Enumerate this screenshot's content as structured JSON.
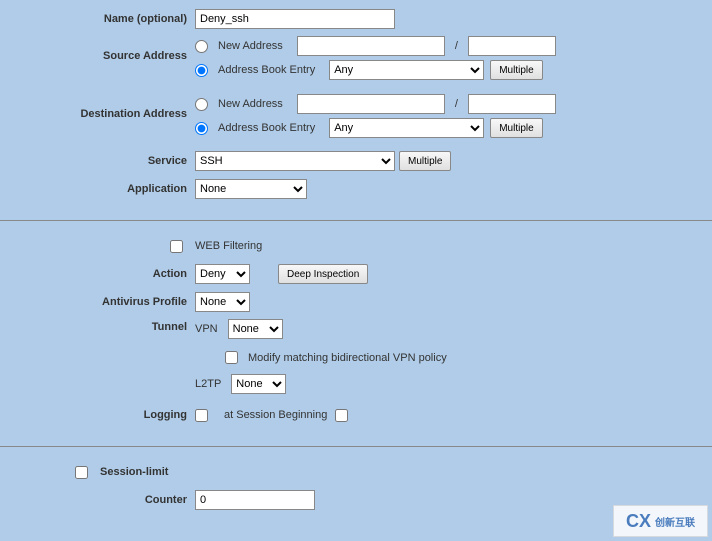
{
  "name": {
    "label": "Name (optional)",
    "value": "Deny_ssh"
  },
  "source_address": {
    "label": "Source Address",
    "new_label": "New Address",
    "book_label": "Address Book Entry",
    "book_value": "Any",
    "multiple_btn": "Multiple"
  },
  "destination_address": {
    "label": "Destination Address",
    "new_label": "New Address",
    "book_label": "Address Book Entry",
    "book_value": "Any",
    "multiple_btn": "Multiple"
  },
  "service": {
    "label": "Service",
    "value": "SSH",
    "multiple_btn": "Multiple"
  },
  "application": {
    "label": "Application",
    "value": "None"
  },
  "web_filtering": {
    "label": "WEB Filtering"
  },
  "action": {
    "label": "Action",
    "value": "Deny",
    "deep_btn": "Deep Inspection"
  },
  "antivirus": {
    "label": "Antivirus Profile",
    "value": "None"
  },
  "tunnel": {
    "label": "Tunnel",
    "vpn_label": "VPN",
    "vpn_value": "None",
    "modify_label": "Modify matching bidirectional VPN policy",
    "l2tp_label": "L2TP",
    "l2tp_value": "None"
  },
  "logging": {
    "label": "Logging",
    "session_label": "at Session Beginning"
  },
  "session_limit": {
    "label": "Session-limit"
  },
  "counter": {
    "label": "Counter",
    "value": "0"
  },
  "watermark": {
    "text": "创新互联"
  }
}
